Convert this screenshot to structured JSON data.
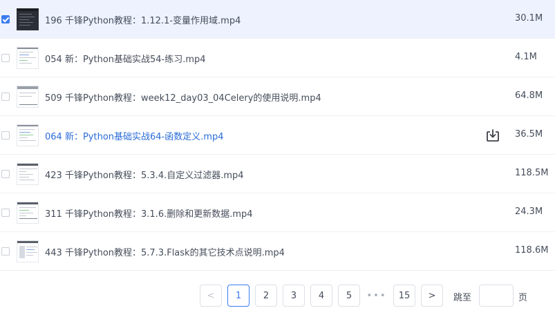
{
  "files": [
    {
      "name": "196 千锋Python教程：1.12.1-变量作用域.mp4",
      "size": "30.1M",
      "checked": true,
      "thumb": "dark"
    },
    {
      "name": "054 新：Python基础实战54-练习.mp4",
      "size": "4.1M",
      "checked": false,
      "thumb": "code"
    },
    {
      "name": "509 千锋Python教程：week12_day03_04Celery的使用说明.mp4",
      "size": "64.8M",
      "checked": false,
      "thumb": "plain"
    },
    {
      "name": "064 新：Python基础实战64-函数定义.mp4",
      "size": "36.5M",
      "checked": false,
      "thumb": "code"
    },
    {
      "name": "423 千锋Python教程：5.3.4.自定义过滤器.mp4",
      "size": "118.5M",
      "checked": false,
      "thumb": "window"
    },
    {
      "name": "311 千锋Python教程：3.1.6.删除和更新数据.mp4",
      "size": "24.3M",
      "checked": false,
      "thumb": "window"
    },
    {
      "name": "443 千锋Python教程：5.7.3.Flask的其它技术点说明.mp4",
      "size": "118.6M",
      "checked": false,
      "thumb": "window"
    }
  ],
  "hovered_row_index": 3,
  "row_action_icon": "download-icon",
  "pagination": {
    "prev_label": "<",
    "pages": [
      "1",
      "2",
      "3",
      "4",
      "5"
    ],
    "current": "1",
    "ellipsis": "•••",
    "last_page": "15",
    "next_label": ">",
    "jump_prefix": "跳至",
    "jump_suffix": "页",
    "jump_value": ""
  },
  "colors": {
    "accent": "#3b7bf0",
    "link": "#2a6bd8",
    "selected_row_bg": "#eef2fe",
    "text": "#454d5a",
    "border": "#dcdfe6"
  }
}
